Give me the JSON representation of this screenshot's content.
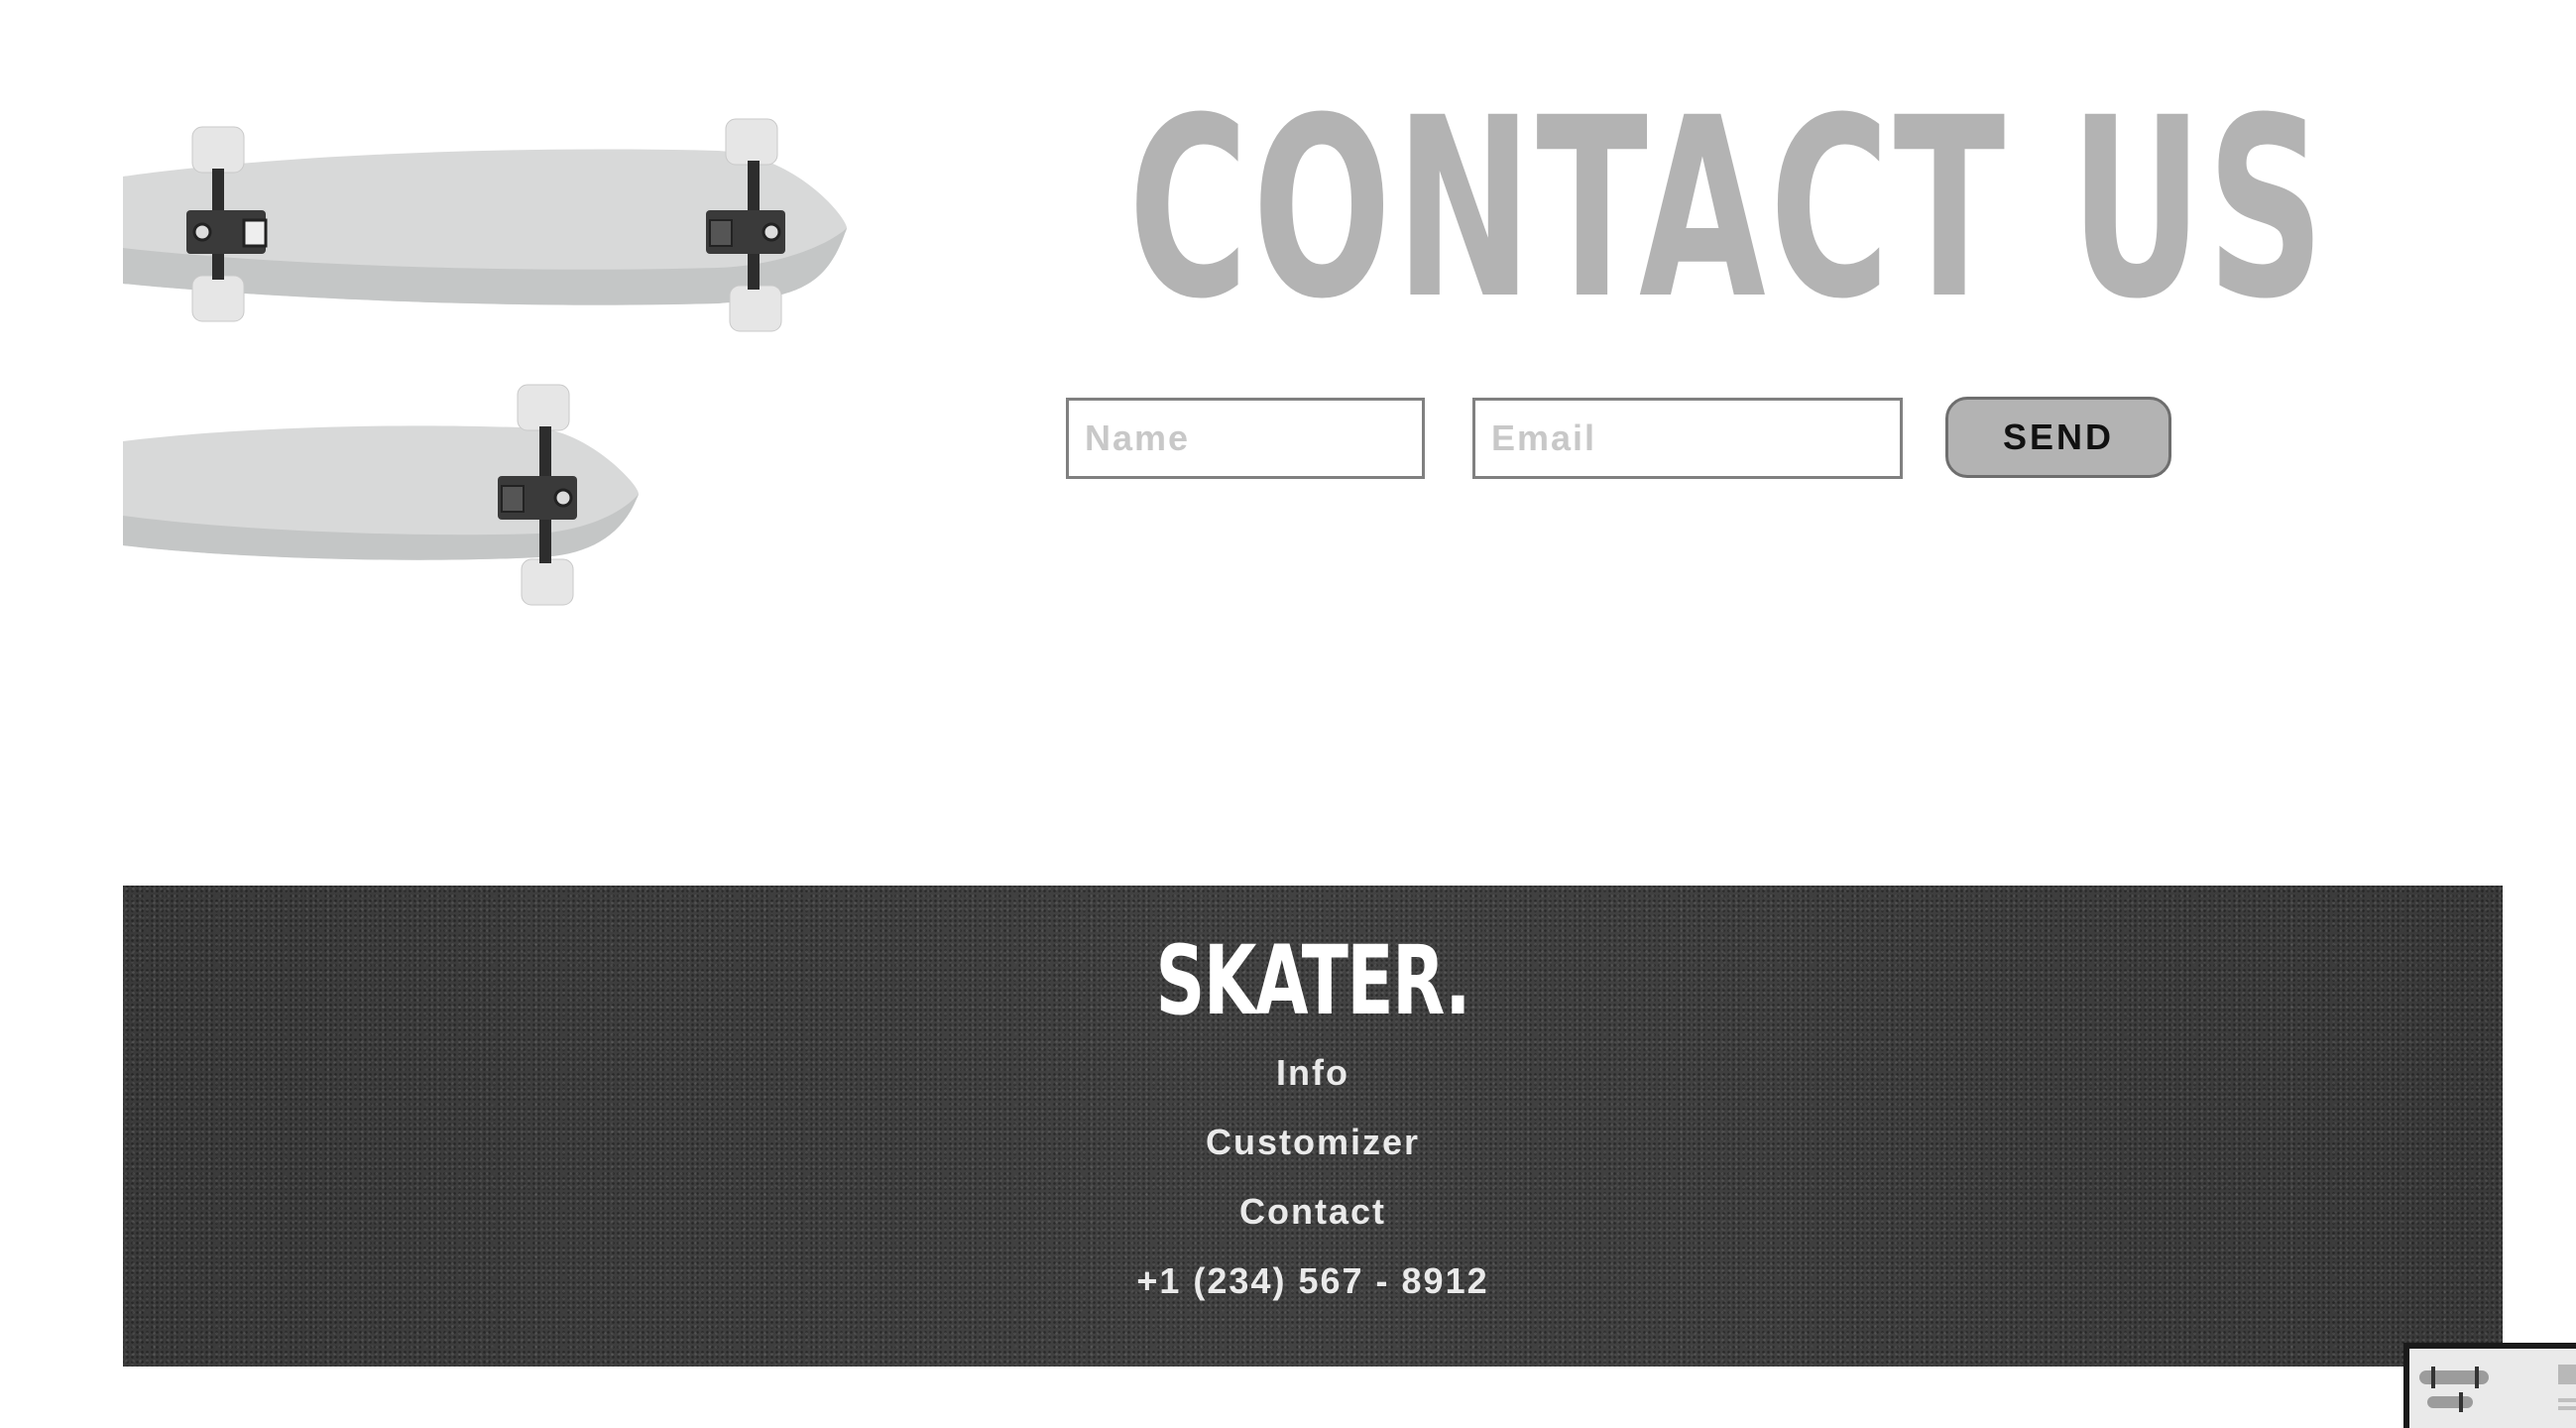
{
  "contact": {
    "title": "CONTACT US",
    "name_placeholder": "Name",
    "email_placeholder": "Email",
    "send_label": "SEND"
  },
  "footer": {
    "logo": "SKATER.",
    "links": [
      "Info",
      "Customizer",
      "Contact"
    ],
    "phone": "+1 (234) 567 - 8912"
  },
  "colors": {
    "title_gray": "#b3b3b3",
    "button_fill": "#b3b3b3",
    "footer_bg": "#3d3d3d",
    "board_deck": "#d8d9d9"
  },
  "icons": [
    "skateboard-image",
    "skateboard-image"
  ]
}
